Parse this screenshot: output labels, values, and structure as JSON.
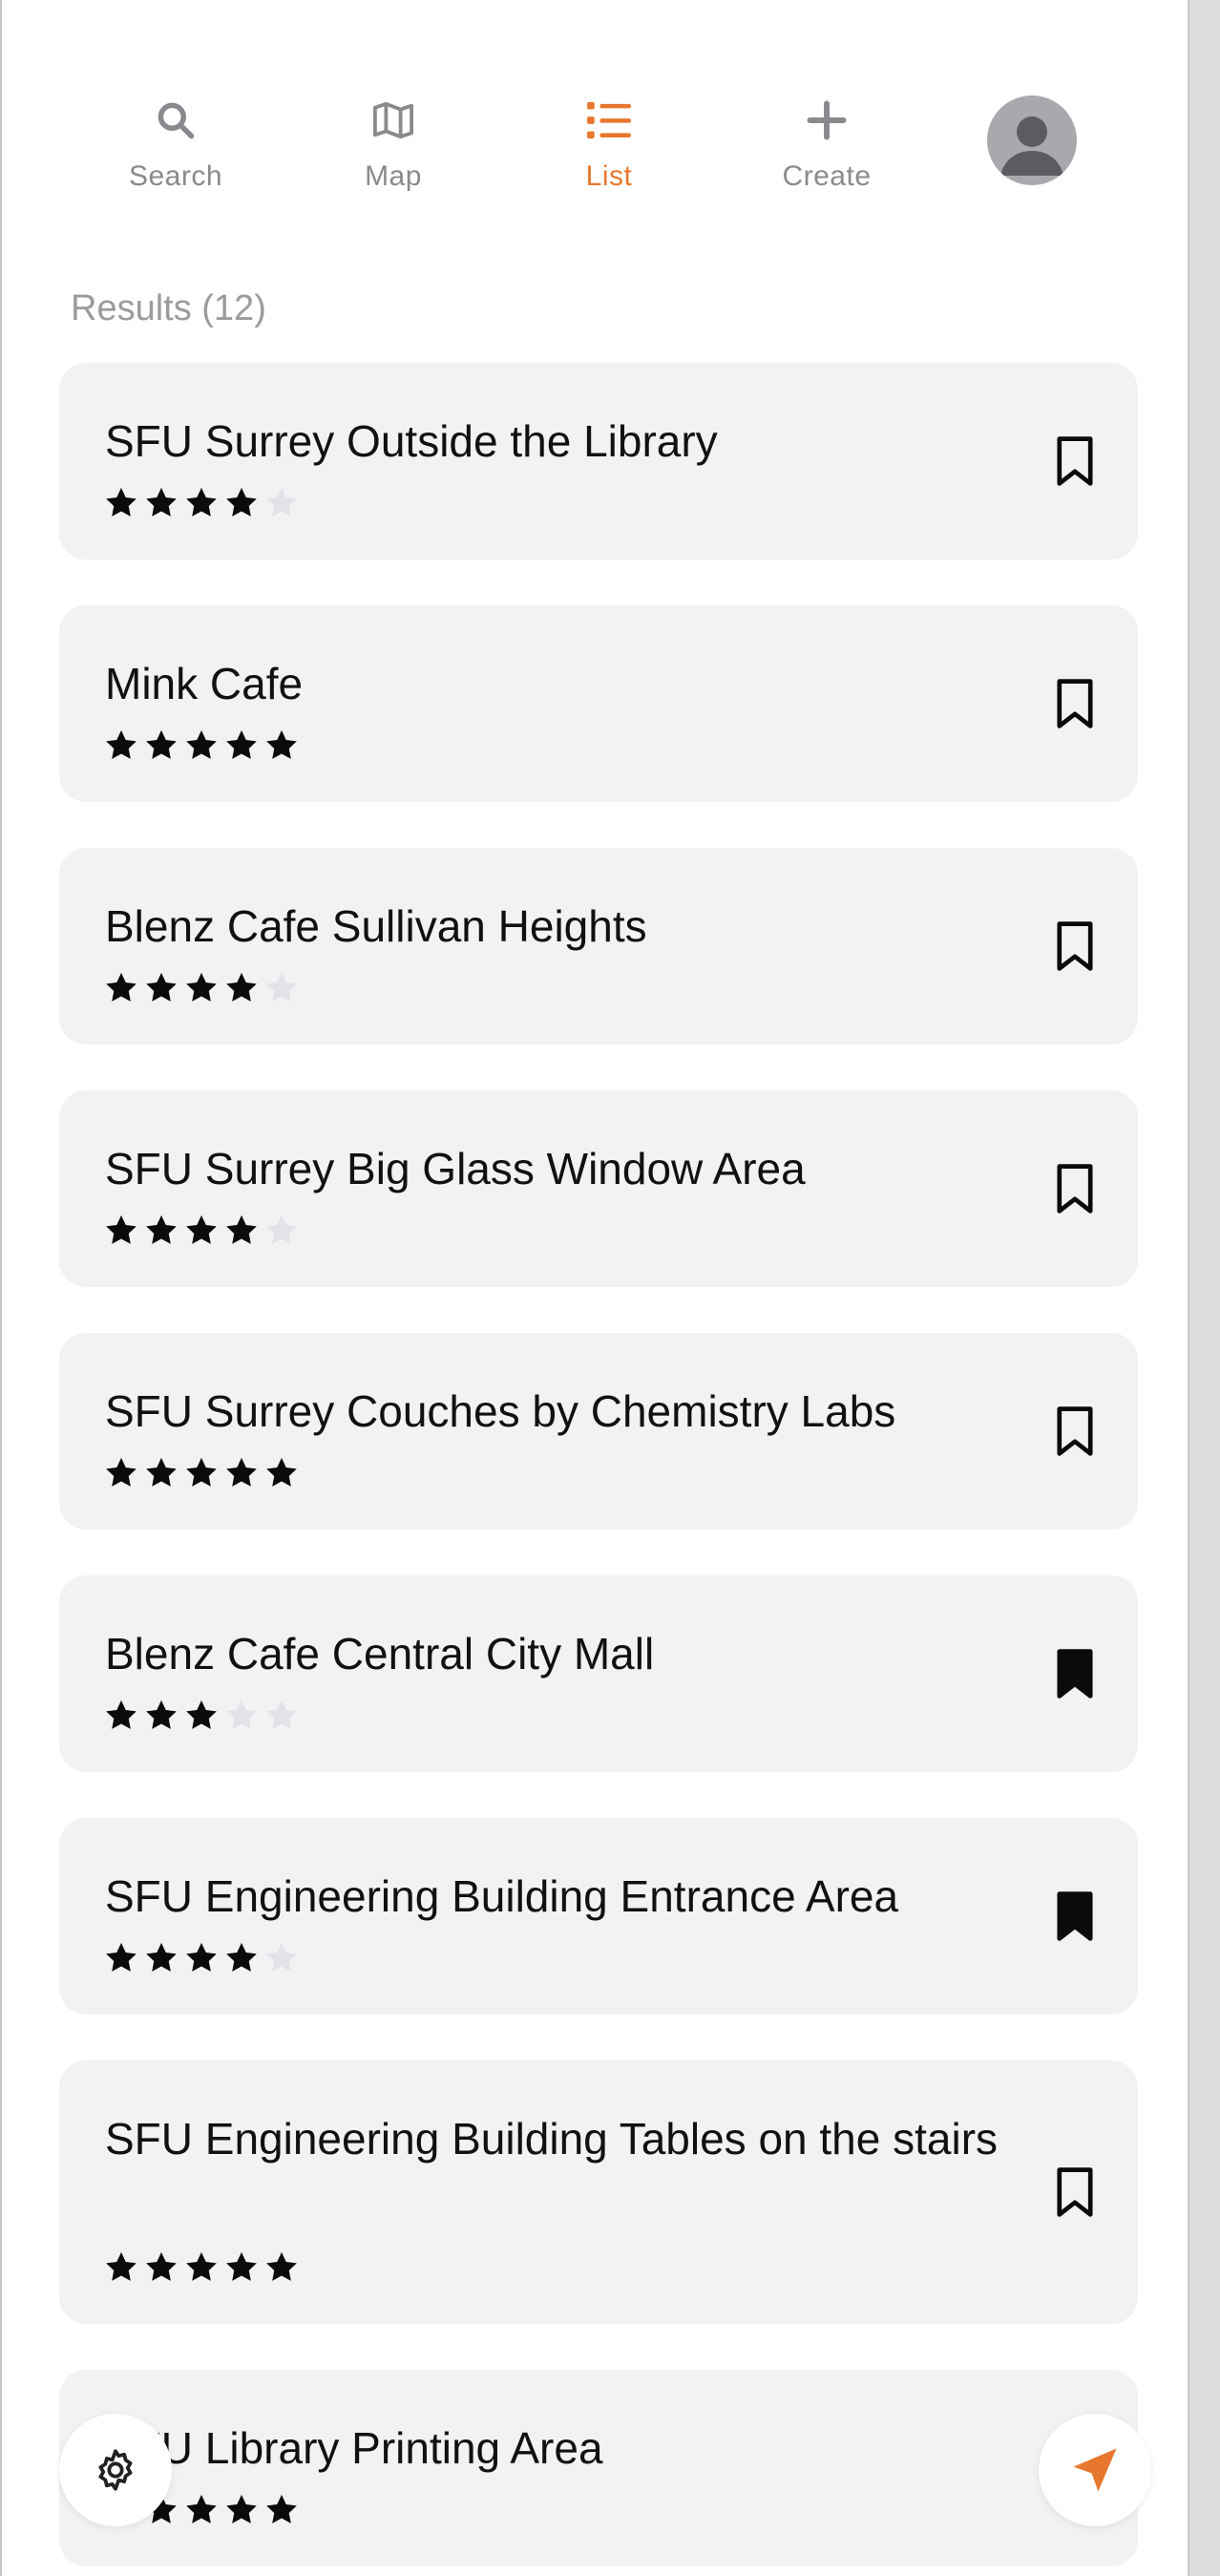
{
  "nav": {
    "items": [
      {
        "label": "Search",
        "icon": "search-icon"
      },
      {
        "label": "Map",
        "icon": "map-icon"
      },
      {
        "label": "List",
        "icon": "list-icon"
      },
      {
        "label": "Create",
        "icon": "plus-icon"
      }
    ],
    "active": "List"
  },
  "colors": {
    "accent": "#e8772e",
    "card": "#f1f2f4",
    "muted": "#9b9b9f"
  },
  "results_label": "Results (12)",
  "places": [
    {
      "name": "SFU Surrey Outside the Library",
      "rating": 4,
      "bookmarked": false
    },
    {
      "name": "Mink Cafe",
      "rating": 5,
      "bookmarked": false
    },
    {
      "name": "Blenz Cafe Sullivan Heights",
      "rating": 4,
      "bookmarked": false
    },
    {
      "name": "SFU Surrey Big Glass Window Area",
      "rating": 4,
      "bookmarked": false
    },
    {
      "name": "SFU Surrey Couches by Chemistry Labs",
      "rating": 5,
      "bookmarked": false
    },
    {
      "name": "Blenz Cafe Central City Mall",
      "rating": 3,
      "bookmarked": true
    },
    {
      "name": "SFU Engineering Building Entrance Area",
      "rating": 4,
      "bookmarked": true
    },
    {
      "name": "SFU Engineering Building Tables on the stairs",
      "rating": 5,
      "bookmarked": false
    },
    {
      "name": "SFU Library Printing Area",
      "rating": 5,
      "bookmarked": false
    }
  ],
  "fabs": {
    "settings_icon": "gear-icon",
    "locate_icon": "navigation-arrow-icon"
  }
}
